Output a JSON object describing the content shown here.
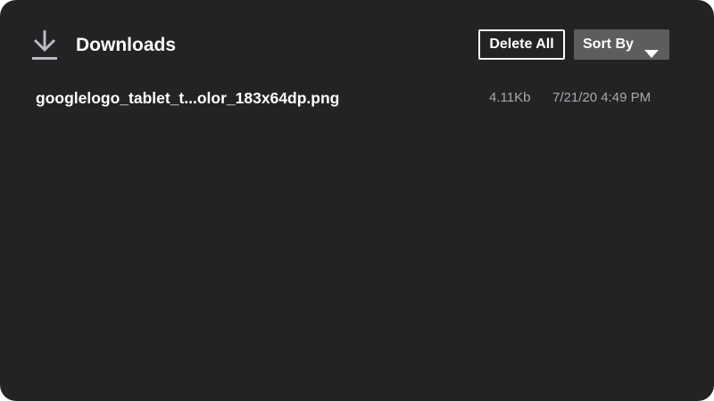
{
  "header": {
    "icon": "download-icon",
    "title": "Downloads",
    "delete_all_label": "Delete All",
    "sort_label": "Sort By",
    "sort_icon": "caret-down-icon"
  },
  "downloads": [
    {
      "name": "googlelogo_tablet_t...olor_183x64dp.png",
      "size": "4.11Kb",
      "date": "7/21/20 4:49 PM"
    }
  ],
  "colors": {
    "background": "#222325",
    "primary_text": "#ffffff",
    "secondary_text": "#a7a8aa",
    "sort_button_bg": "#5c5d5f",
    "icon": "#b8babd"
  }
}
